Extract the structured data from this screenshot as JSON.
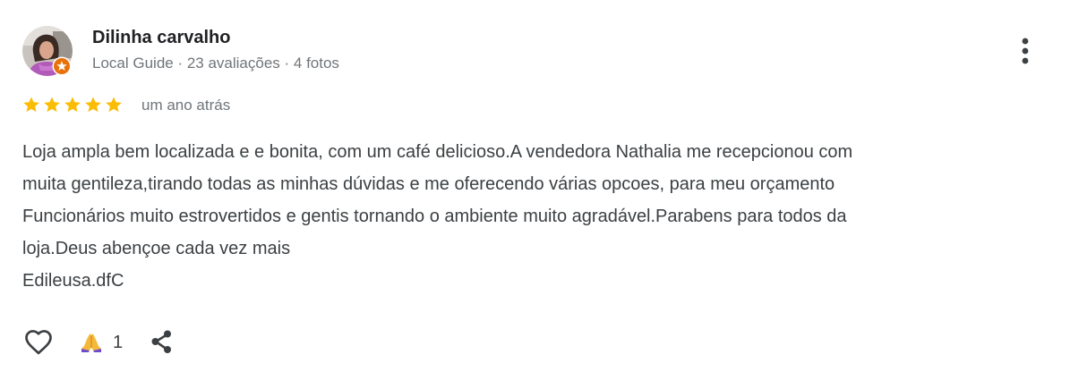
{
  "review": {
    "author": {
      "name": "Dilinha carvalho",
      "meta": "Local Guide · 23 avaliações · 4 fotos"
    },
    "rating": 5,
    "timestamp": "um ano atrás",
    "text_lines": [
      "Loja ampla bem localizada e e bonita, com um café delicioso.A vendedora Nathalia me recepcionou com",
      "muita gentileza,tirando todas as minhas dúvidas e me oferecendo várias opcoes, para meu orçamento",
      "Funcionários muito estrovertidos e gentis tornando o ambiente muito agradável.Parabens para todos da",
      "loja.Deus abençoe cada vez mais",
      "Edileusa.dfC"
    ],
    "actions": {
      "reaction_count": "1"
    }
  },
  "icons": {
    "avatar": "profile-photo",
    "badge": "local-guide-badge-icon",
    "more": "more-vert-icon",
    "star": "star-icon",
    "like": "heart-outline-icon",
    "reaction": "folded-hands-emoji",
    "share": "share-icon"
  },
  "colors": {
    "star": "#fbbc04",
    "badge": "#e8710a",
    "secondary_text": "#70757a",
    "body_text": "#3c4043",
    "icon": "#3c4043"
  }
}
